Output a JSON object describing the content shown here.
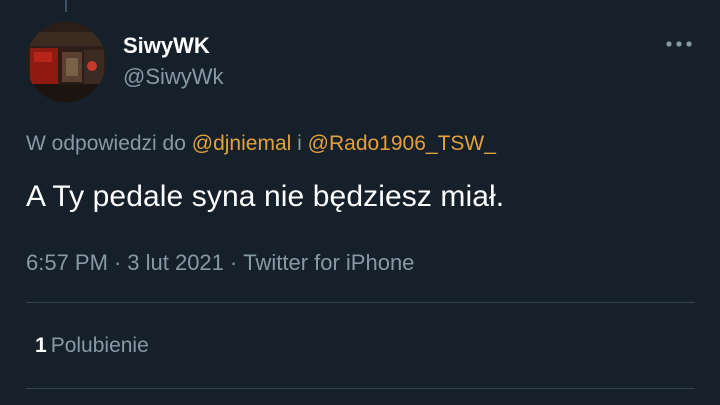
{
  "author": {
    "display_name": "SiwyWK",
    "handle": "@SiwyWk"
  },
  "reply": {
    "prefix": "W odpowiedzi do",
    "mention_1": "@djniemal",
    "conjunction": "i",
    "mention_2": "@Rado1906_TSW_"
  },
  "tweet": {
    "text": "A Ty pedale syna nie będziesz miał."
  },
  "meta": {
    "time": "6:57 PM",
    "separator": "·",
    "date": "3 lut 2021",
    "source": "Twitter for iPhone"
  },
  "stats": {
    "likes_count": "1",
    "likes_label": "Polubienie"
  },
  "icons": {
    "more": "more-horizontal-icon"
  },
  "colors": {
    "background": "#15202b",
    "text_primary": "#ffffff",
    "text_secondary": "#8899a6",
    "mention": "#e2a13b",
    "divider": "#38444d"
  }
}
